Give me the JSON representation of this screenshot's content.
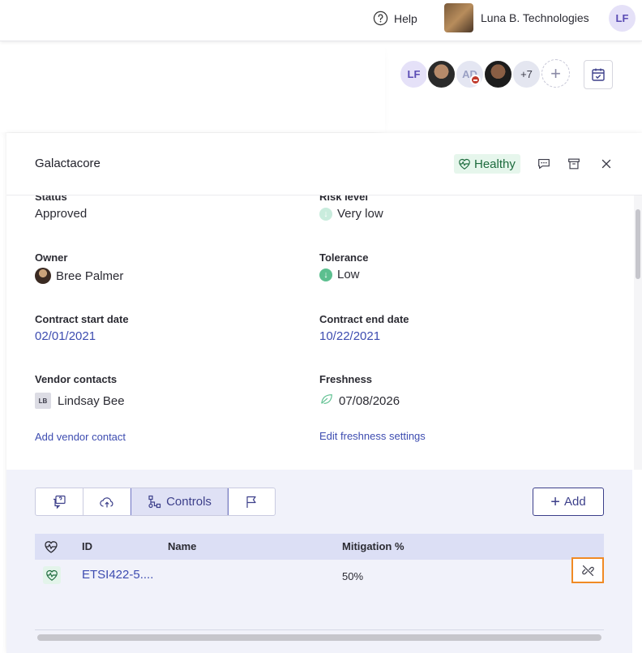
{
  "topbar": {
    "help_label": "Help",
    "org_name": "Luna B. Technologies",
    "user_initials": "LF"
  },
  "collaborators": {
    "first_initials": "LF",
    "third_initials": "AD",
    "overflow_count": "+7"
  },
  "panel": {
    "vendor_name": "Galactacore",
    "health_label": "Healthy"
  },
  "details": {
    "status_label": "Status",
    "status_value": "Approved",
    "risk_label": "Risk level",
    "risk_value": "Very low",
    "owner_label": "Owner",
    "owner_value": "Bree Palmer",
    "tolerance_label": "Tolerance",
    "tolerance_value": "Low",
    "contract_start_label": "Contract start date",
    "contract_start_value": "02/01/2021",
    "contract_end_label": "Contract end date",
    "contract_end_value": "10/22/2021",
    "vendor_contacts_label": "Vendor contacts",
    "vendor_contact_initials": "LB",
    "vendor_contact_name": "Lindsay Bee",
    "freshness_label": "Freshness",
    "freshness_value": "07/08/2026",
    "add_vendor_contact": "Add vendor contact",
    "edit_freshness": "Edit freshness settings"
  },
  "tabs": {
    "controls_label": "Controls",
    "active": "Controls"
  },
  "add_button_label": "Add",
  "controls_table": {
    "headers": {
      "id": "ID",
      "name": "Name",
      "mitigation": "Mitigation %"
    },
    "rows": [
      {
        "id": "ETSI422-5....",
        "name": "",
        "mitigation": "50%"
      }
    ]
  },
  "colors": {
    "accent": "#3c3f8a",
    "link": "#3d4cb0",
    "healthy_bg": "#e6f6ec",
    "healthy_text": "#1d6b3d",
    "highlight": "#f08a24"
  },
  "icons": {
    "help": "help-circle-icon",
    "calendar": "calendar-check-icon",
    "comment": "comment-icon",
    "archive": "archive-icon",
    "close": "close-icon",
    "health": "heartbeat-icon",
    "unlink": "unlink-icon"
  }
}
